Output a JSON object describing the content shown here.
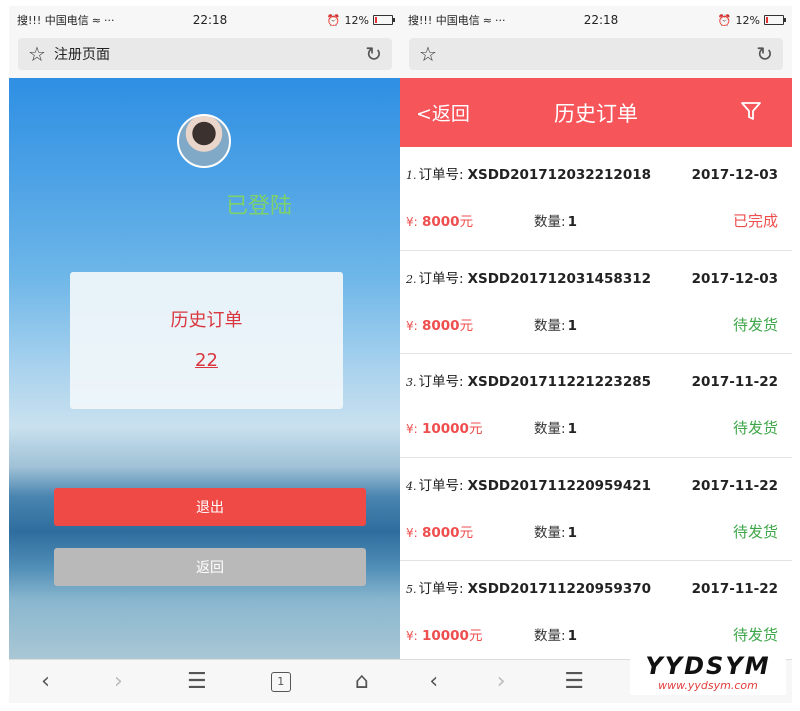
{
  "status_bar": {
    "left": "搜!!! 中国电信",
    "time": "22:18",
    "battery": "12%",
    "battery_level": 0.12,
    "accent_battery": "#e33333"
  },
  "left_screen": {
    "url_title": "注册页面",
    "logged_in_text": "已登陆",
    "history_label": "历史订单",
    "history_count": "22",
    "logout_label": "退出",
    "back_label": "返回",
    "tab_count": "1"
  },
  "right_screen": {
    "back_label": "<返回",
    "title": "历史订单",
    "header_color": "#f6555a",
    "order_no_label": "订单号:",
    "qty_label": "数量:",
    "currency": "¥:",
    "orders": [
      {
        "index": "1.",
        "order_no": "XSDD201712032212018",
        "date": "2017-12-03",
        "amount": "8000",
        "unit": "元",
        "qty": "1",
        "status": "已完成",
        "status_type": "done"
      },
      {
        "index": "2.",
        "order_no": "XSDD201712031458312",
        "date": "2017-12-03",
        "amount": "8000",
        "unit": "元",
        "qty": "1",
        "status": "待发货",
        "status_type": "pending"
      },
      {
        "index": "3.",
        "order_no": "XSDD201711221223285",
        "date": "2017-11-22",
        "amount": "10000",
        "unit": "元",
        "qty": "1",
        "status": "待发货",
        "status_type": "pending"
      },
      {
        "index": "4.",
        "order_no": "XSDD201711220959421",
        "date": "2017-11-22",
        "amount": "8000",
        "unit": "元",
        "qty": "1",
        "status": "待发货",
        "status_type": "pending"
      },
      {
        "index": "5.",
        "order_no": "XSDD201711220959370",
        "date": "2017-11-22",
        "amount": "10000",
        "unit": "元",
        "qty": "1",
        "status": "待发货",
        "status_type": "pending"
      }
    ]
  },
  "watermark": {
    "brand": "YYDSYM",
    "url": "www.yydsym.com"
  },
  "icons": [
    "star-icon",
    "reload-icon",
    "back-arrow-icon",
    "forward-arrow-icon",
    "menu-icon",
    "home-icon",
    "filter-icon",
    "wifi-icon",
    "alarm-icon",
    "battery-icon"
  ]
}
